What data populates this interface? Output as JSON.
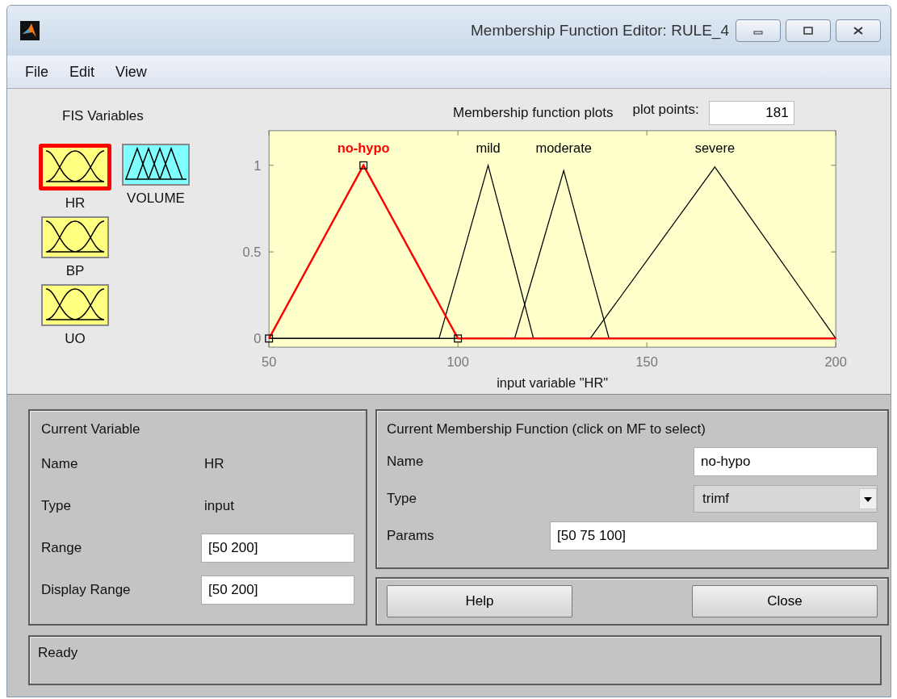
{
  "window": {
    "title": "Membership Function Editor: RULE_4"
  },
  "menu": [
    "File",
    "Edit",
    "View"
  ],
  "fis_variables": {
    "title": "FIS Variables",
    "items": [
      {
        "name": "HR",
        "kind": "input",
        "selected": true
      },
      {
        "name": "VOLUME",
        "kind": "output",
        "selected": false
      },
      {
        "name": "BP",
        "kind": "input",
        "selected": false
      },
      {
        "name": "UO",
        "kind": "input",
        "selected": false
      }
    ]
  },
  "plot_header": {
    "title": "Membership function plots",
    "plot_points_label": "plot points:",
    "plot_points": "181"
  },
  "chart_data": {
    "type": "line",
    "xlabel": "input variable \"HR\"",
    "x": [
      50,
      75,
      95,
      100,
      108,
      115,
      120,
      128,
      135,
      140,
      168,
      200
    ],
    "series": [
      {
        "name": "no-hypo",
        "color": "#ff0000",
        "values": [
          0,
          1,
          0.2,
          0,
          0,
          0,
          0,
          0,
          0,
          0,
          0,
          0
        ]
      },
      {
        "name": "mild",
        "color": "#000000",
        "values": [
          0,
          0,
          0,
          0.38,
          1,
          0.42,
          0,
          0,
          0,
          0,
          0,
          0
        ]
      },
      {
        "name": "moderate",
        "color": "#000000",
        "values": [
          0,
          0,
          0,
          0,
          0,
          0,
          0.37,
          0.97,
          0.4,
          0,
          0,
          0
        ]
      },
      {
        "name": "severe",
        "color": "#000000",
        "values": [
          0,
          0,
          0,
          0,
          0,
          0,
          0,
          0,
          0,
          0.15,
          0.99,
          0
        ]
      }
    ],
    "xlim": [
      50,
      200
    ],
    "ylim": [
      -0.05,
      1.2
    ],
    "xticks": [
      50,
      100,
      150,
      200
    ],
    "yticks": [
      0,
      0.5,
      1
    ]
  },
  "membership_functions": [
    {
      "selected": true
    },
    {
      "selected": false
    },
    {
      "selected": false
    },
    {
      "selected": false
    }
  ],
  "current_variable": {
    "title": "Current Variable",
    "name_label": "Name",
    "name": "HR",
    "type_label": "Type",
    "type": "input",
    "range_label": "Range",
    "range": "[50 200]",
    "display_range_label": "Display Range",
    "display_range": "[50 200]"
  },
  "current_mf": {
    "title": "Current Membership Function (click on MF to select)",
    "name_label": "Name",
    "name": "no-hypo",
    "type_label": "Type",
    "type": "trimf",
    "params_label": "Params",
    "params": "[50 75 100]"
  },
  "buttons": [
    "Help",
    "Close"
  ],
  "status": "Ready"
}
